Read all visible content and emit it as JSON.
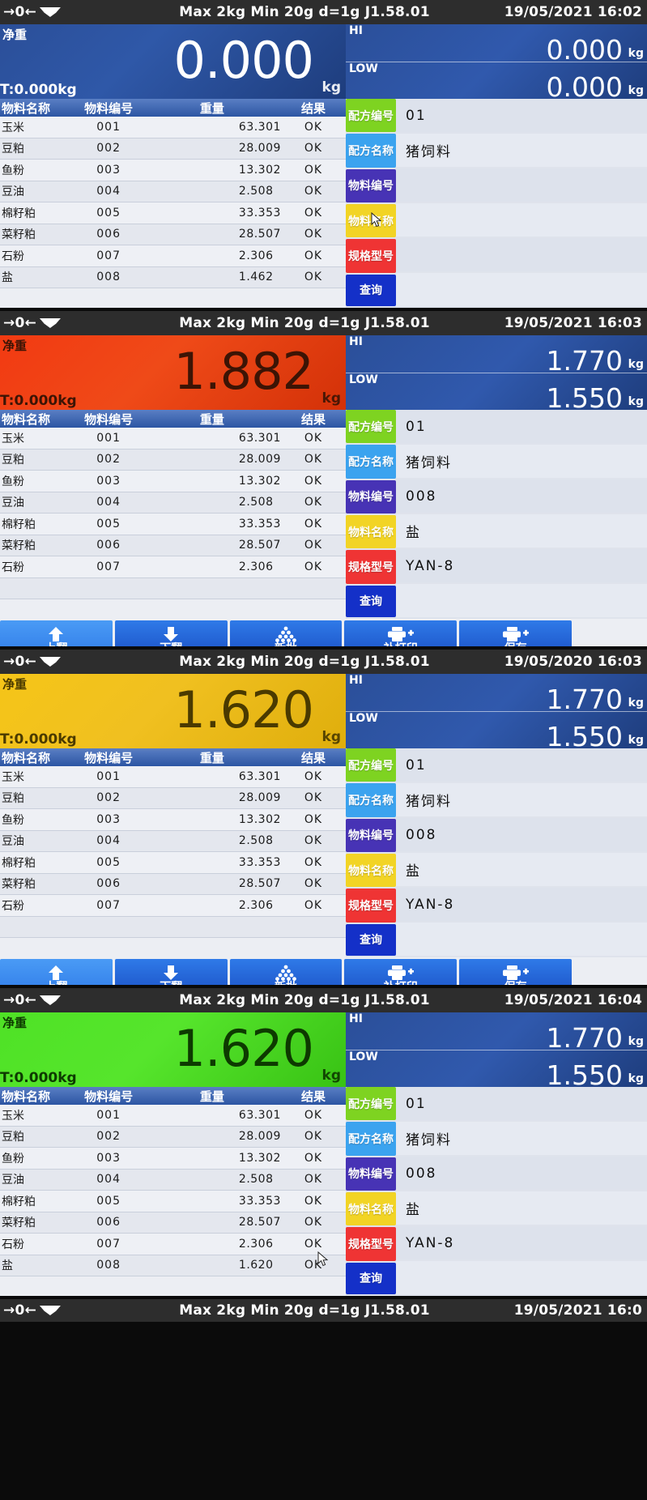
{
  "device": {
    "spec_text": "Max 2kg  Min 20g  d=1g    J1.58.01",
    "zero_icon": "→0←",
    "net_label": "净重",
    "tare_label": "T:0.000kg",
    "unit": "kg",
    "hi_tag": "HI",
    "low_tag": "LOW"
  },
  "table": {
    "headers": {
      "name": "物料名称",
      "no": "物料编号",
      "weight": "重量",
      "result": "结果"
    }
  },
  "form_labels": {
    "recipe_no": "配方编号",
    "recipe_name": "配方名称",
    "material_no": "物料编号",
    "material_name": "物料名称",
    "spec_model": "规格型号",
    "query": "查询"
  },
  "form_colors": {
    "recipe_no": "#7ed321",
    "recipe_name": "#3ba3ef",
    "material_no": "#4733b5",
    "material_name": "#f2d425",
    "spec_model": "#ef3434",
    "query": "#1430c8"
  },
  "buttons": [
    {
      "label": "上翻",
      "icon": "arrow-up-icon"
    },
    {
      "label": "下翻",
      "icon": "arrow-down-icon"
    },
    {
      "label": "新批",
      "icon": "batch-stack-icon"
    },
    {
      "label": "补打印",
      "icon": "printer-plus-icon"
    },
    {
      "label": "保存",
      "icon": "printer-plus-icon"
    }
  ],
  "panels": [
    {
      "datetime": "19/05/2021  16:02",
      "weight": "0.000",
      "weight_state": "blue",
      "hi": "0.000",
      "low": "0.000",
      "form": {
        "recipe_no": "01",
        "recipe_name": "猪饲料",
        "material_no": "",
        "material_name": "",
        "spec_model": ""
      },
      "rows": [
        {
          "name": "玉米",
          "no": "001",
          "weight": "63.301",
          "result": "OK"
        },
        {
          "name": "豆粕",
          "no": "002",
          "weight": "28.009",
          "result": "OK"
        },
        {
          "name": "鱼粉",
          "no": "003",
          "weight": "13.302",
          "result": "OK"
        },
        {
          "name": "豆油",
          "no": "004",
          "weight": "2.508",
          "result": "OK"
        },
        {
          "name": "棉籽粕",
          "no": "005",
          "weight": "33.353",
          "result": "OK"
        },
        {
          "name": "菜籽粕",
          "no": "006",
          "weight": "28.507",
          "result": "OK"
        },
        {
          "name": "石粉",
          "no": "007",
          "weight": "2.306",
          "result": "OK"
        },
        {
          "name": "盐",
          "no": "008",
          "weight": "1.462",
          "result": "OK"
        }
      ]
    },
    {
      "datetime": "19/05/2021  16:03",
      "weight": "1.882",
      "weight_state": "red",
      "hi": "1.770",
      "low": "1.550",
      "form": {
        "recipe_no": "01",
        "recipe_name": "猪饲料",
        "material_no": "008",
        "material_name": "盐",
        "spec_model": "YAN-8"
      },
      "rows": [
        {
          "name": "玉米",
          "no": "001",
          "weight": "63.301",
          "result": "OK"
        },
        {
          "name": "豆粕",
          "no": "002",
          "weight": "28.009",
          "result": "OK"
        },
        {
          "name": "鱼粉",
          "no": "003",
          "weight": "13.302",
          "result": "OK"
        },
        {
          "name": "豆油",
          "no": "004",
          "weight": "2.508",
          "result": "OK"
        },
        {
          "name": "棉籽粕",
          "no": "005",
          "weight": "33.353",
          "result": "OK"
        },
        {
          "name": "菜籽粕",
          "no": "006",
          "weight": "28.507",
          "result": "OK"
        },
        {
          "name": "石粉",
          "no": "007",
          "weight": "2.306",
          "result": "OK"
        },
        {
          "name": "",
          "no": "",
          "weight": "",
          "result": ""
        }
      ]
    },
    {
      "datetime": "19/05/2020  16:03",
      "weight": "1.620",
      "weight_state": "yellow",
      "hi": "1.770",
      "low": "1.550",
      "form": {
        "recipe_no": "01",
        "recipe_name": "猪饲料",
        "material_no": "008",
        "material_name": "盐",
        "spec_model": "YAN-8"
      },
      "rows": [
        {
          "name": "玉米",
          "no": "001",
          "weight": "63.301",
          "result": "OK"
        },
        {
          "name": "豆粕",
          "no": "002",
          "weight": "28.009",
          "result": "OK"
        },
        {
          "name": "鱼粉",
          "no": "003",
          "weight": "13.302",
          "result": "OK"
        },
        {
          "name": "豆油",
          "no": "004",
          "weight": "2.508",
          "result": "OK"
        },
        {
          "name": "棉籽粕",
          "no": "005",
          "weight": "33.353",
          "result": "OK"
        },
        {
          "name": "菜籽粕",
          "no": "006",
          "weight": "28.507",
          "result": "OK"
        },
        {
          "name": "石粉",
          "no": "007",
          "weight": "2.306",
          "result": "OK"
        },
        {
          "name": "",
          "no": "",
          "weight": "",
          "result": ""
        }
      ]
    },
    {
      "datetime": "19/05/2021  16:04",
      "weight": "1.620",
      "weight_state": "green",
      "hi": "1.770",
      "low": "1.550",
      "form": {
        "recipe_no": "01",
        "recipe_name": "猪饲料",
        "material_no": "008",
        "material_name": "盐",
        "spec_model": "YAN-8"
      },
      "rows": [
        {
          "name": "玉米",
          "no": "001",
          "weight": "63.301",
          "result": "OK"
        },
        {
          "name": "豆粕",
          "no": "002",
          "weight": "28.009",
          "result": "OK"
        },
        {
          "name": "鱼粉",
          "no": "003",
          "weight": "13.302",
          "result": "OK"
        },
        {
          "name": "豆油",
          "no": "004",
          "weight": "2.508",
          "result": "OK"
        },
        {
          "name": "棉籽粕",
          "no": "005",
          "weight": "33.353",
          "result": "OK"
        },
        {
          "name": "菜籽粕",
          "no": "006",
          "weight": "28.507",
          "result": "OK"
        },
        {
          "name": "石粉",
          "no": "007",
          "weight": "2.306",
          "result": "OK"
        },
        {
          "name": "盐",
          "no": "008",
          "weight": "1.620",
          "result": "OK"
        }
      ]
    }
  ],
  "bottom_strip": {
    "datetime": "19/05/2021  16:0",
    "spec_text": "Max 2kg  Min 20g  d=1g    J1.58.01"
  }
}
